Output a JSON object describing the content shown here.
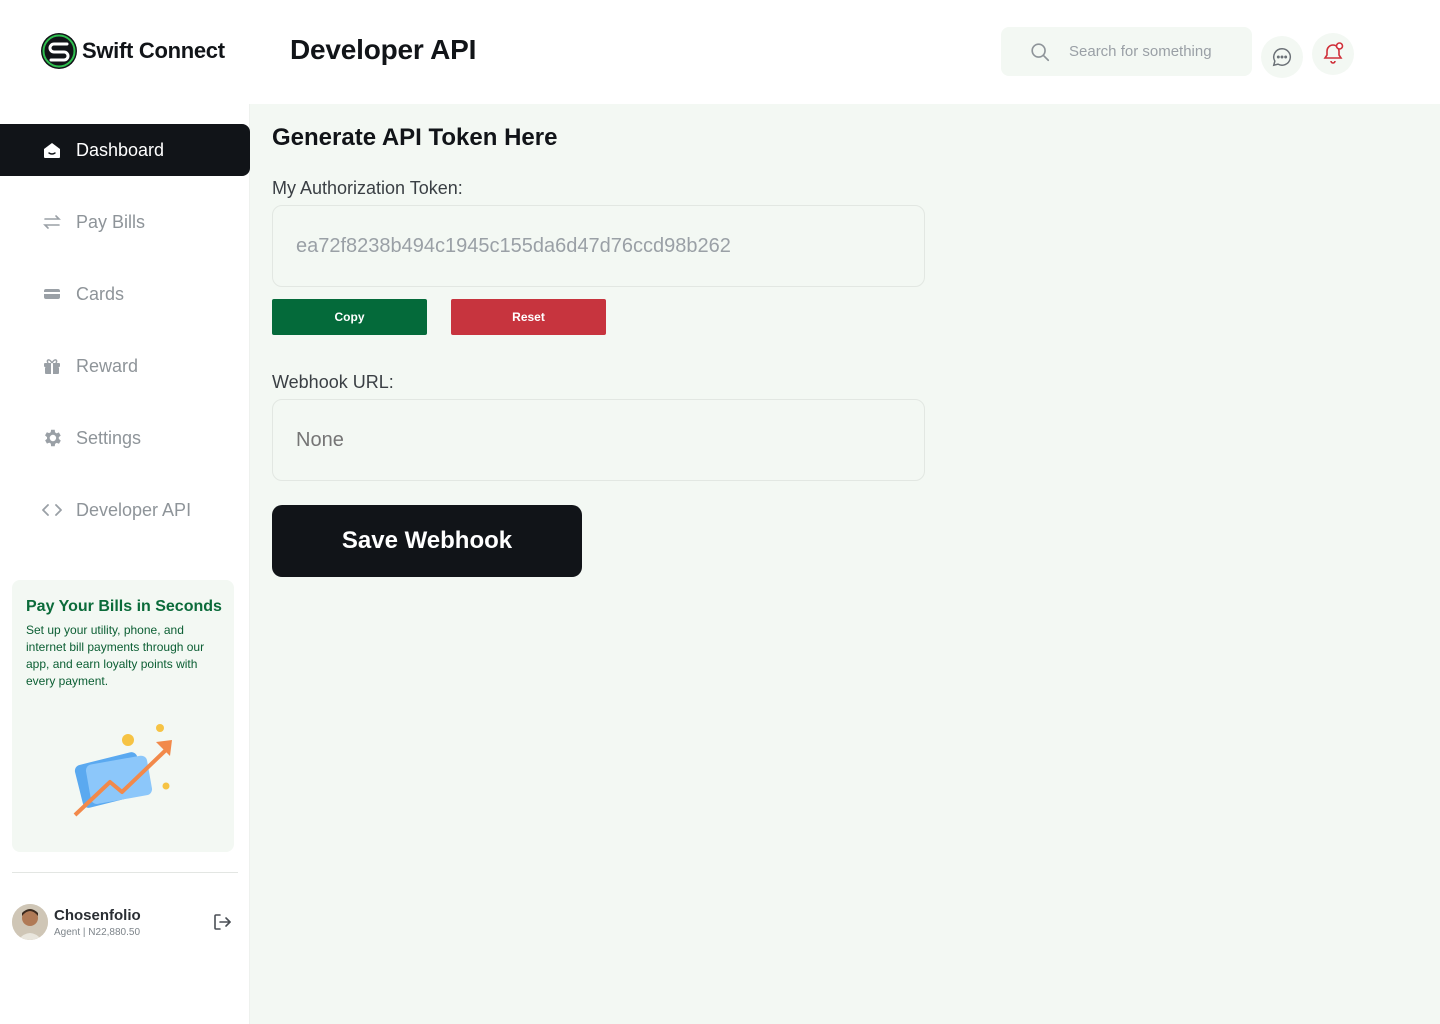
{
  "header": {
    "app_name": "Swift Connect",
    "page_title": "Developer API",
    "search": {
      "placeholder": "Search for something",
      "value": ""
    },
    "icons": [
      "search-icon",
      "chat-icon",
      "bell-icon"
    ]
  },
  "sidebar": {
    "items": [
      {
        "label": "Dashboard",
        "icon": "home-icon",
        "active": true
      },
      {
        "label": "Pay Bills",
        "icon": "transfer-arrows-icon",
        "active": false
      },
      {
        "label": "Cards",
        "icon": "card-icon",
        "active": false
      },
      {
        "label": "Reward",
        "icon": "gift-icon",
        "active": false
      },
      {
        "label": "Settings",
        "icon": "gear-icon",
        "active": false
      },
      {
        "label": "Developer API",
        "icon": "code-icon",
        "active": false
      }
    ],
    "promo": {
      "title": "Pay Your Bills in Seconds",
      "text": "Set up your utility, phone, and internet bill payments through our app, and earn loyalty points with every payment."
    },
    "profile": {
      "name": "Chosenfolio",
      "role": "Agent",
      "balance": "N22,880.50"
    }
  },
  "main": {
    "title": "Generate API Token Here",
    "token_label": "My Authorization Token:",
    "token_value": "ea72f8238b494c1945c155da6d47d76ccd98b262",
    "copy_label": "Copy",
    "reset_label": "Reset",
    "webhook_label": "Webhook URL:",
    "webhook_placeholder": "None",
    "save_label": "Save Webhook"
  },
  "colors": {
    "brand_green": "#046a3a",
    "danger_red": "#c7343e",
    "dark": "#111418",
    "surface": "#f3f8f3"
  }
}
